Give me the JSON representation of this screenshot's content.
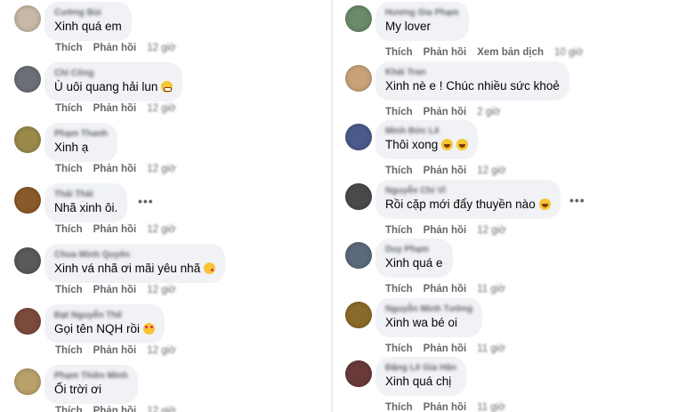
{
  "actions": {
    "like": "Thích",
    "reply": "Phản hồi",
    "translate": "Xem bản dịch"
  },
  "left": [
    {
      "author": "Cường Bùi",
      "text": "Xinh quá em",
      "emoji": "",
      "time": "12 giờ",
      "avatar_color": "#c8b9a6"
    },
    {
      "author": "Chí Công",
      "text": "Ù uôi quang hải lun",
      "emoji": "grimace",
      "time": "12 giờ",
      "avatar_color": "#6b6f78"
    },
    {
      "author": "Phạm Thanh",
      "text": "Xinh ạ",
      "emoji": "",
      "time": "12 giờ",
      "avatar_color": "#9a8a4a"
    },
    {
      "author": "Thái Thái",
      "text": "Nhã xinh ôi.",
      "emoji": "",
      "time": "12 giờ",
      "avatar_color": "#8a5a2a"
    },
    {
      "author": "Chua Minh Quyên",
      "text": "Xinh vá nhã ơi mãi yêu nhã",
      "emoji": "kiss",
      "time": "12 giờ",
      "avatar_color": "#5a5a5a"
    },
    {
      "author": "Đạt Nguyễn Thế",
      "text": "Gọi tên NQH rồi",
      "emoji": "hearteyes",
      "time": "12 giờ",
      "avatar_color": "#7a4a3a"
    },
    {
      "author": "Phạm Thiên Minh",
      "text": "Ối trời ơi",
      "emoji": "",
      "time": "12 giờ",
      "avatar_color": "#b8a26a"
    }
  ],
  "right": [
    {
      "author": "Hương Gia Phạm",
      "text": "My lover",
      "emoji": "",
      "time": "10 giờ",
      "avatar_color": "#6a8a6a",
      "translate": true
    },
    {
      "author": "Khải Tran",
      "text": "Xinh nè e ! Chúc nhiều sức khoẻ",
      "emoji": "",
      "time": "2 giờ",
      "avatar_color": "#c9a27a"
    },
    {
      "author": "Minh Đức Lê",
      "text": "Thôi xong",
      "emoji": "laugh2",
      "time": "12 giờ",
      "avatar_color": "#4a5a8a"
    },
    {
      "author": "Nguyễn Chí Vĩ",
      "text": "Rồi cặp mới đẩy thuyền nào",
      "emoji": "laugh",
      "time": "12 giờ",
      "avatar_color": "#4a4a4a"
    },
    {
      "author": "Duy Phạm",
      "text": "Xinh quá e",
      "emoji": "",
      "time": "11 giờ",
      "avatar_color": "#5a6a7a"
    },
    {
      "author": "Nguyễn Minh Tường",
      "text": "Xinh wa bé oi",
      "emoji": "",
      "time": "11 giờ",
      "avatar_color": "#8a6a2a"
    },
    {
      "author": "Đặng Lê Gia Hân",
      "text": "Xinh quá chị",
      "emoji": "",
      "time": "11 giờ",
      "avatar_color": "#6a3a3a"
    }
  ],
  "more_label": "•••"
}
